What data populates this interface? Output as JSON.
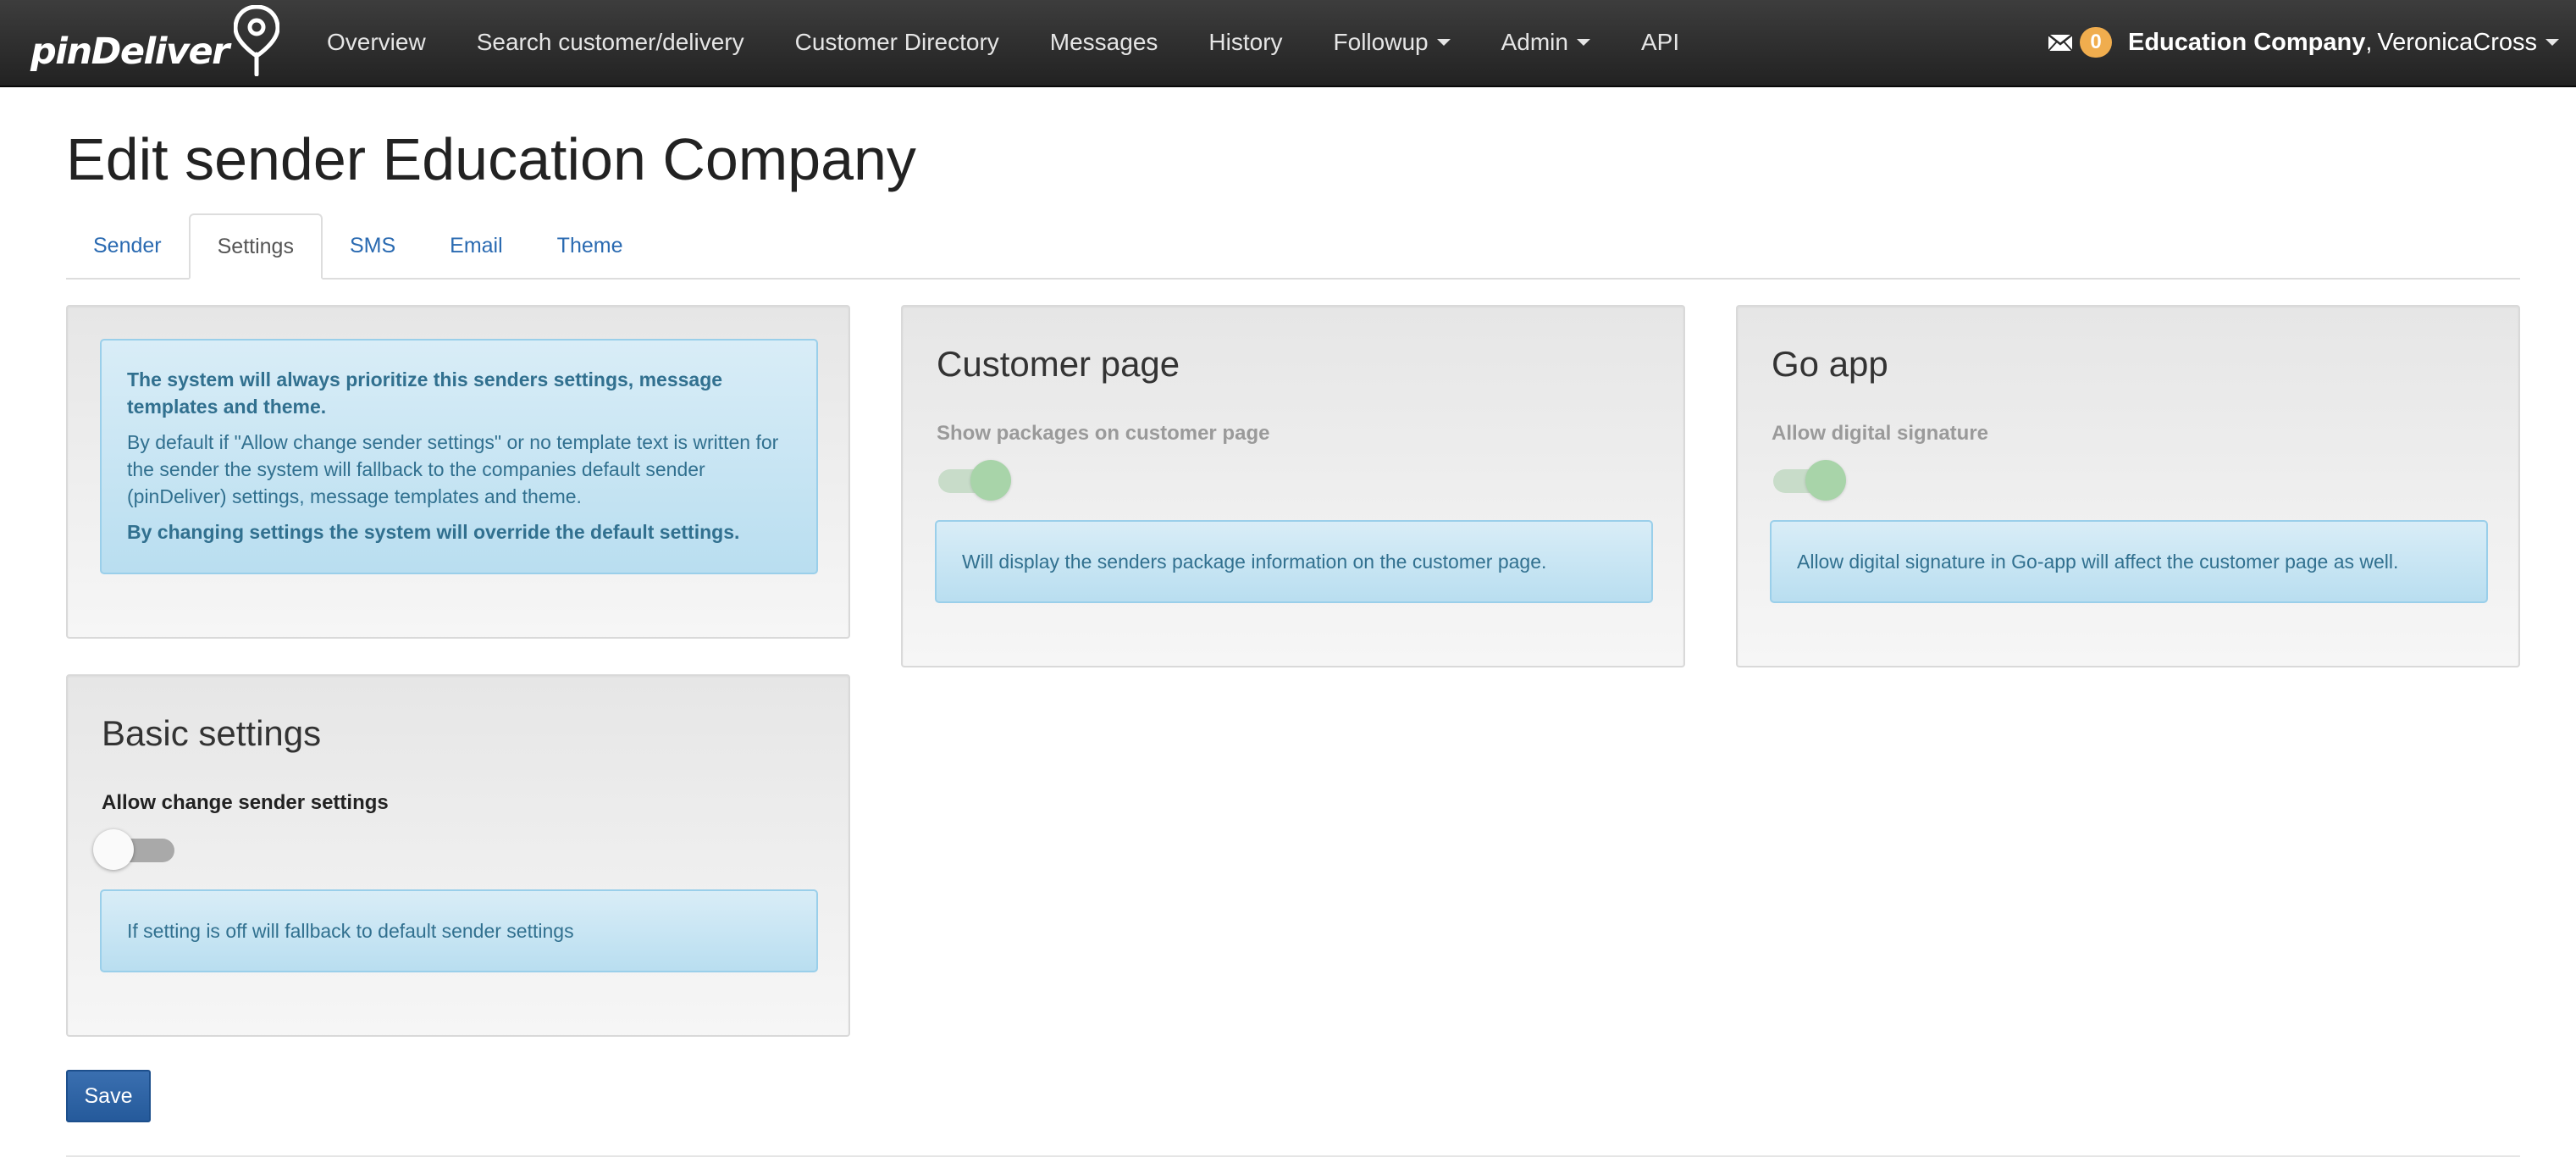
{
  "brand": {
    "name": "pinDeliver"
  },
  "nav": {
    "items": [
      {
        "label": "Overview",
        "dropdown": false
      },
      {
        "label": "Search customer/delivery",
        "dropdown": false
      },
      {
        "label": "Customer Directory",
        "dropdown": false
      },
      {
        "label": "Messages",
        "dropdown": false
      },
      {
        "label": "History",
        "dropdown": false
      },
      {
        "label": "Followup",
        "dropdown": true
      },
      {
        "label": "Admin",
        "dropdown": true
      },
      {
        "label": "API",
        "dropdown": false
      }
    ],
    "messages_count": "0",
    "user_company": "Education Company",
    "user_name": "VeronicaCross"
  },
  "page": {
    "title": "Edit sender Education Company"
  },
  "tabs": [
    {
      "label": "Sender",
      "active": false
    },
    {
      "label": "Settings",
      "active": true
    },
    {
      "label": "SMS",
      "active": false
    },
    {
      "label": "Email",
      "active": false
    },
    {
      "label": "Theme",
      "active": false
    }
  ],
  "info_panel": {
    "line1": "The system will always prioritize this senders settings, message templates and theme.",
    "line2": "By default if \"Allow change sender settings\" or no template text is written for the sender the system will fallback to the companies default sender (pinDeliver) settings, message templates and theme.",
    "line3": "By changing settings the system will override the default settings."
  },
  "customer_page": {
    "title": "Customer page",
    "setting_label": "Show packages on customer page",
    "setting_on": true,
    "info": "Will display the senders package information on the customer page."
  },
  "go_app": {
    "title": "Go app",
    "setting_label": "Allow digital signature",
    "setting_on": true,
    "info": "Allow digital signature in Go-app will affect the customer page as well."
  },
  "basic_settings": {
    "title": "Basic settings",
    "setting_label": "Allow change sender settings",
    "setting_on": false,
    "info": "If setting is off will fallback to default sender settings"
  },
  "actions": {
    "save_label": "Save"
  },
  "colors": {
    "navbar": "#222222",
    "link": "#2a6ab1",
    "badge": "#f0ad4e",
    "alert_bg": "#d9edf7",
    "alert_text": "#31708f",
    "toggle_on": "#a8d4a9",
    "save_button": "#255a9b"
  }
}
